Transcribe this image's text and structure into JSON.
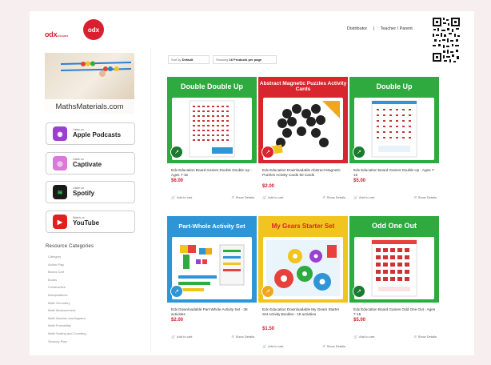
{
  "header": {
    "logo_text": "odx",
    "logo_sub": "educator",
    "logo_badge": "odx",
    "nav": [
      "Distributor",
      "Teacher / Parent"
    ],
    "brand_color": "#d01c2a"
  },
  "sidebar": {
    "banner_label": "MathsMaterials.com",
    "podcasts": [
      {
        "small": "Listen on",
        "name": "Apple Podcasts",
        "icon": "apple-podcasts-icon",
        "color": "#9b3fd1"
      },
      {
        "small": "Listen on",
        "name": "Captivate",
        "icon": "captivate-icon",
        "color": "#d97ad8"
      },
      {
        "small": "Listen on",
        "name": "Spotify",
        "icon": "spotify-icon",
        "color": "#1a1a1a"
      },
      {
        "small": "Watch on",
        "name": "YouTube",
        "icon": "youtube-icon",
        "color": "#e02020"
      }
    ],
    "categories_title": "Resource Categories",
    "categories": [
      "Category",
      "Action Play",
      "Bonus Cart",
      "Books",
      "Constructive",
      "Manipulatives",
      "Math Geometry",
      "Math Measurement",
      "Math Number and Algebra",
      "Math Probability",
      "Math Sorting and Counting",
      "Sensory Play"
    ]
  },
  "toolbar": {
    "sort_prefix": "Sort by",
    "sort_value": "Default",
    "show_prefix": "Showing",
    "show_value": "16 Products per page"
  },
  "products": [
    {
      "band": "Double Double Up",
      "band_color": "#2eaa3f",
      "name": "Edx Education Board Games Double Double Up - Ages 7-15",
      "price": "$6.00",
      "cart": "Add to cart",
      "details": "Show Details"
    },
    {
      "band": "Abstract Magnetic Puzzles Activity Cards",
      "band_color": "#d9262e",
      "name": "Edx Education Downloadable Abstract Magnetic Puzzles Activity Cards 50 Cards",
      "price": "$2.00",
      "cart": "Add to cart",
      "details": "Show Details"
    },
    {
      "band": "Double Up",
      "band_color": "#2eaa3f",
      "name": "Edx Education Board Games Double Up - Ages 7-15",
      "price": "$5.00",
      "cart": "Add to cart",
      "details": "Show Details"
    },
    {
      "band": "Part-Whole Activity Set",
      "band_color": "#2e96d6",
      "name": "Edx Downloadable Part-Whole Activity Set - 38 activities",
      "price": "$2.00",
      "cart": "Add to cart",
      "details": "Show Details"
    },
    {
      "band": "My Gears Starter Set",
      "band_color": "#f2c41e",
      "name": "Edx Education Downloadable My Gears Starter Set Activity Booklet - 15 activities",
      "price": "$1.50",
      "cart": "Add to cart",
      "details": "Show Details"
    },
    {
      "band": "Odd One Out",
      "band_color": "#2eaa3f",
      "name": "Edx Education Board Games Odd One Out - Ages 7-15",
      "price": "$5.00",
      "cart": "Add to cart",
      "details": "Show Details"
    }
  ]
}
